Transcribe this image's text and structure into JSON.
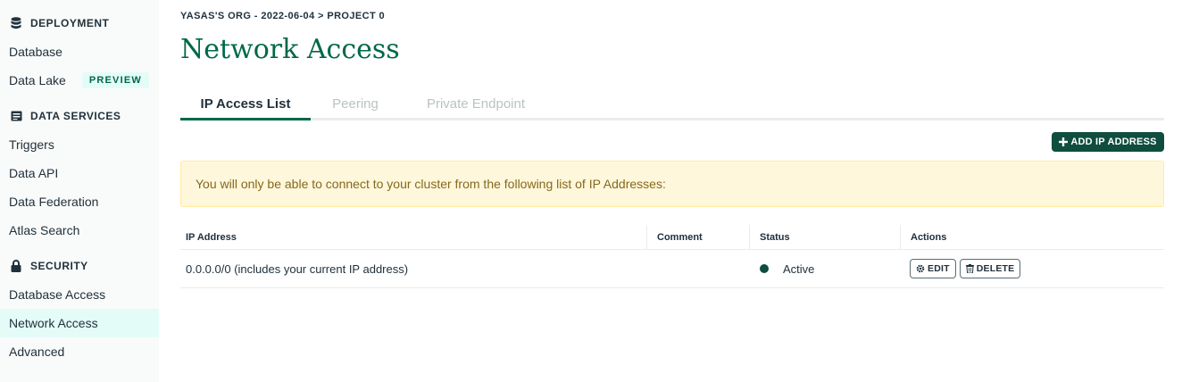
{
  "sidebar": {
    "sections": [
      {
        "title": "DEPLOYMENT",
        "icon": "database-icon"
      },
      {
        "title": "DATA SERVICES",
        "icon": "document-icon"
      },
      {
        "title": "SECURITY",
        "icon": "lock-icon"
      }
    ],
    "items": [
      {
        "label": "Database"
      },
      {
        "label": "Data Lake",
        "badge": "PREVIEW"
      },
      {
        "label": "Triggers"
      },
      {
        "label": "Data API"
      },
      {
        "label": "Data Federation"
      },
      {
        "label": "Atlas Search"
      },
      {
        "label": "Database Access"
      },
      {
        "label": "Network Access",
        "active": true
      },
      {
        "label": "Advanced"
      }
    ]
  },
  "breadcrumb": "YASAS'S ORG - 2022-06-04 > PROJECT 0",
  "page_title": "Network Access",
  "tabs": [
    {
      "label": "IP Access List",
      "active": true
    },
    {
      "label": "Peering"
    },
    {
      "label": "Private Endpoint"
    }
  ],
  "add_button_label": "ADD IP ADDRESS",
  "banner_text": "You will only be able to connect to your cluster from the following list of IP Addresses:",
  "table": {
    "headers": [
      "IP Address",
      "Comment",
      "Status",
      "Actions"
    ],
    "rows": [
      {
        "ip_address": "0.0.0.0/0  (includes your current IP address)",
        "comment": "",
        "status": "Active",
        "actions": {
          "edit": "EDIT",
          "delete": "DELETE"
        }
      }
    ]
  },
  "colors": {
    "brand_green": "#00684a",
    "dark_green": "#0f4d3e",
    "active_nav_bg": "#e3fcf7",
    "banner_bg": "#fef7db"
  }
}
